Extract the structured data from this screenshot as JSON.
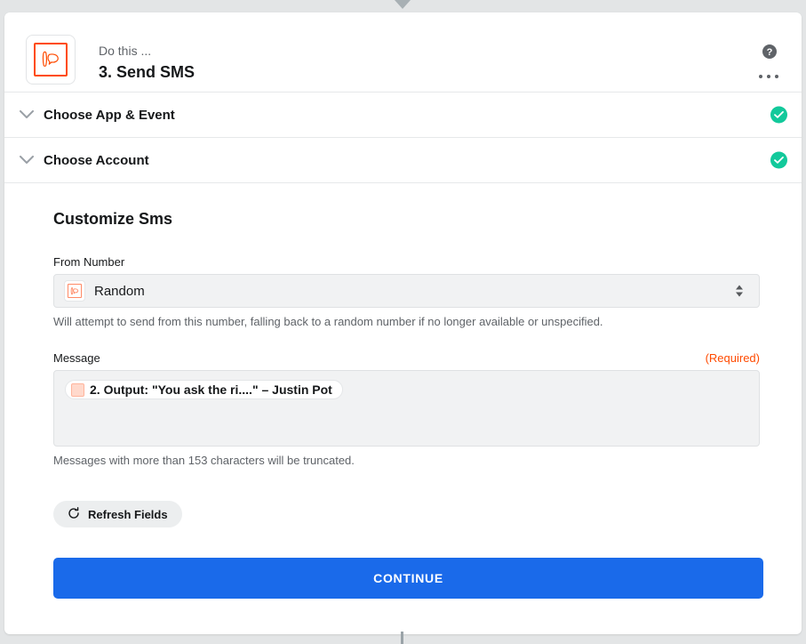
{
  "connector": {
    "top_icon": "arrow-down",
    "bottom_icon": "vertical-line"
  },
  "header": {
    "app_icon": "sms-app-icon",
    "eyebrow": "Do this ...",
    "title": "3. Send SMS",
    "help_icon": "help-circle-icon",
    "more_icon": "more-horizontal-icon"
  },
  "sections": [
    {
      "label": "Choose App & Event",
      "chevron_icon": "chevron-down-icon",
      "status_icon": "check-circle-icon",
      "status_color": "#12c99b"
    },
    {
      "label": "Choose Account",
      "chevron_icon": "chevron-down-icon",
      "status_icon": "check-circle-icon",
      "status_color": "#12c99b"
    }
  ],
  "customize": {
    "title": "Customize Sms",
    "from_number": {
      "label": "From Number",
      "value": "Random",
      "icon": "sms-app-icon",
      "help": "Will attempt to send from this number, falling back to a random number if no longer available or unspecified."
    },
    "message": {
      "label": "Message",
      "required_text": "(Required)",
      "required_color": "#ff4a00",
      "token_icon": "output-field-icon",
      "token_text": "2. Output: \"You ask the ri....\" – Justin Pot",
      "help": "Messages with more than 153 characters will be truncated."
    },
    "refresh_button": {
      "label": "Refresh Fields",
      "icon": "refresh-icon"
    },
    "continue_button": {
      "label": "CONTINUE",
      "color": "#1a6aea"
    }
  }
}
